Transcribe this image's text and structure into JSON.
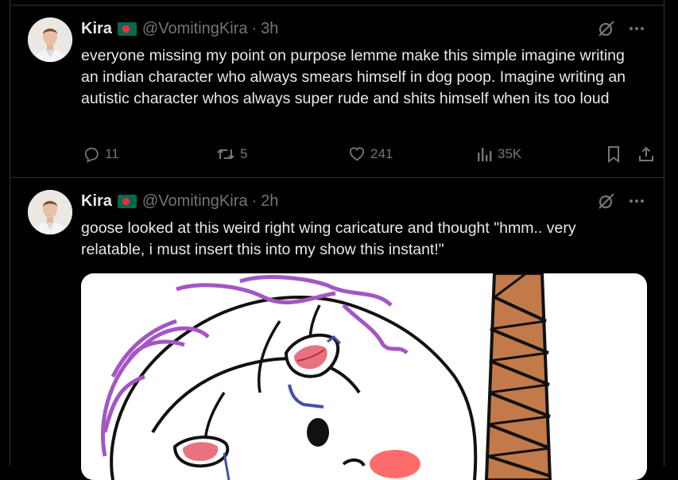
{
  "tweets": [
    {
      "name": "Kira",
      "flag": "bangladesh-flag",
      "handle": "@VomitingKira",
      "separator": "·",
      "time": "3h",
      "text": "everyone missing my point on purpose lemme make this simple imagine writing an indian character who always smears himself in dog poop. Imagine writing an autistic character whos always super rude and shits himself when its too loud",
      "replies": "11",
      "reposts": "5",
      "likes": "241",
      "views": "35K"
    },
    {
      "name": "Kira",
      "flag": "bangladesh-flag",
      "handle": "@VomitingKira",
      "separator": "·",
      "time": "2h",
      "text": "goose looked at this weird right wing caricature and thought \"hmm.. very relatable, i must insert this into my show this instant!\"",
      "media": "drawn-caricature-image"
    }
  ],
  "colors": {
    "background": "#000000",
    "text": "#e7e9ea",
    "muted": "#71767b",
    "border": "#2f3336"
  },
  "icons": [
    "grok-icon",
    "more-icon",
    "reply-icon",
    "repost-icon",
    "like-icon",
    "views-icon",
    "bookmark-icon",
    "share-icon"
  ]
}
